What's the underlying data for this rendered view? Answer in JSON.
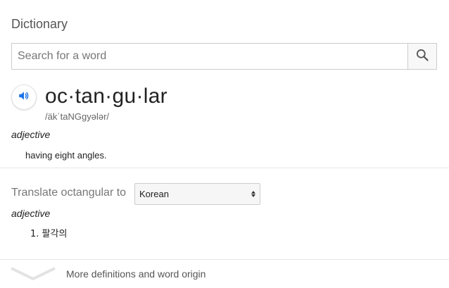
{
  "dictionary": {
    "title": "Dictionary",
    "search": {
      "placeholder": "Search for a word",
      "value": "",
      "icon": "search-icon"
    },
    "entry": {
      "headword": "oc·tan·gu·lar",
      "phonetic": "/äkˈtaNGgyələr/",
      "speaker_icon": "speaker-icon",
      "accent_color": "#1a73e8",
      "part_of_speech": "adjective",
      "definition": "having eight angles."
    },
    "translate": {
      "label": "Translate octangular to",
      "selected_language": "Korean",
      "part_of_speech": "adjective",
      "items": [
        "1. 팔각의"
      ]
    },
    "more": {
      "label": "More definitions and word origin",
      "icon": "chevron-down-icon"
    }
  }
}
